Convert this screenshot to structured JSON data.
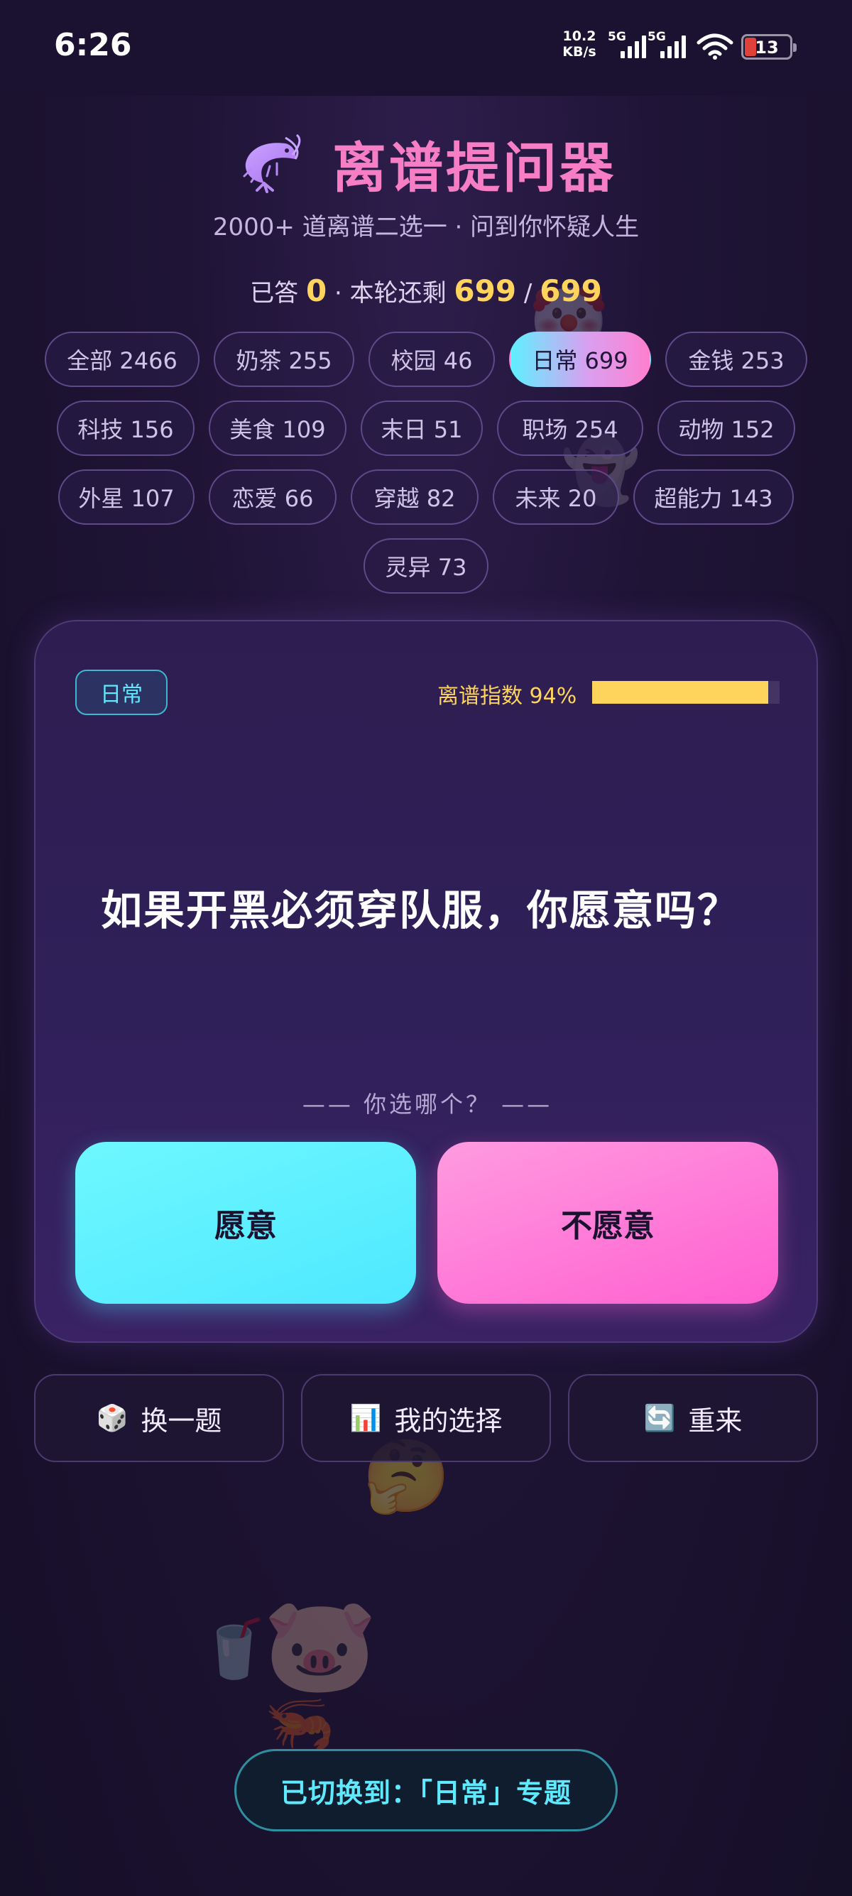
{
  "status_bar": {
    "time": "6:26",
    "net_speed_value": "10.2",
    "net_speed_unit": "KB/s",
    "sim1_tag": "5G",
    "sim2_tag": "5G",
    "battery": "13"
  },
  "header": {
    "title": "离谱提问器",
    "title_icon": "shrimp-icon",
    "subtitle": "2000+ 道离谱二选一 · 问到你怀疑人生",
    "answered_label": "已答",
    "answered_count": "0",
    "sep": "·",
    "remaining_label": "本轮还剩",
    "remaining": "699",
    "slash": "/",
    "total": "699"
  },
  "categories": [
    {
      "label": "全部 2466"
    },
    {
      "label": "奶茶 255"
    },
    {
      "label": "校园 46"
    },
    {
      "label": "日常 699",
      "active": true
    },
    {
      "label": "金钱 253"
    },
    {
      "label": "科技 156"
    },
    {
      "label": "美食 109"
    },
    {
      "label": "末日 51"
    },
    {
      "label": "职场 254"
    },
    {
      "label": "动物 152"
    },
    {
      "label": "外星 107"
    },
    {
      "label": "恋爱 66"
    },
    {
      "label": "穿越 82"
    },
    {
      "label": "未来 20"
    },
    {
      "label": "超能力 143"
    },
    {
      "label": "灵异 73"
    }
  ],
  "card": {
    "category": "日常",
    "absurd_label": "离谱指数 94%",
    "absurd_level": 0.94,
    "question": "如果开黑必须穿队服，你愿意吗？",
    "prompt": "—— 你选哪个？ ——",
    "option_a": "愿意",
    "option_b": "不愿意"
  },
  "actions": {
    "next": {
      "icon": "🎲",
      "label": "换一题"
    },
    "mine": {
      "icon": "📊",
      "label": "我的选择"
    },
    "reset": {
      "icon": "🔄",
      "label": "重来"
    }
  },
  "toast": "已切换到：「日常」专题",
  "colors": {
    "accent_cyan": "#5ee9ff",
    "accent_pink": "#ff6fd3",
    "accent_yellow": "#ffd45c",
    "bg": "#1f1436"
  }
}
